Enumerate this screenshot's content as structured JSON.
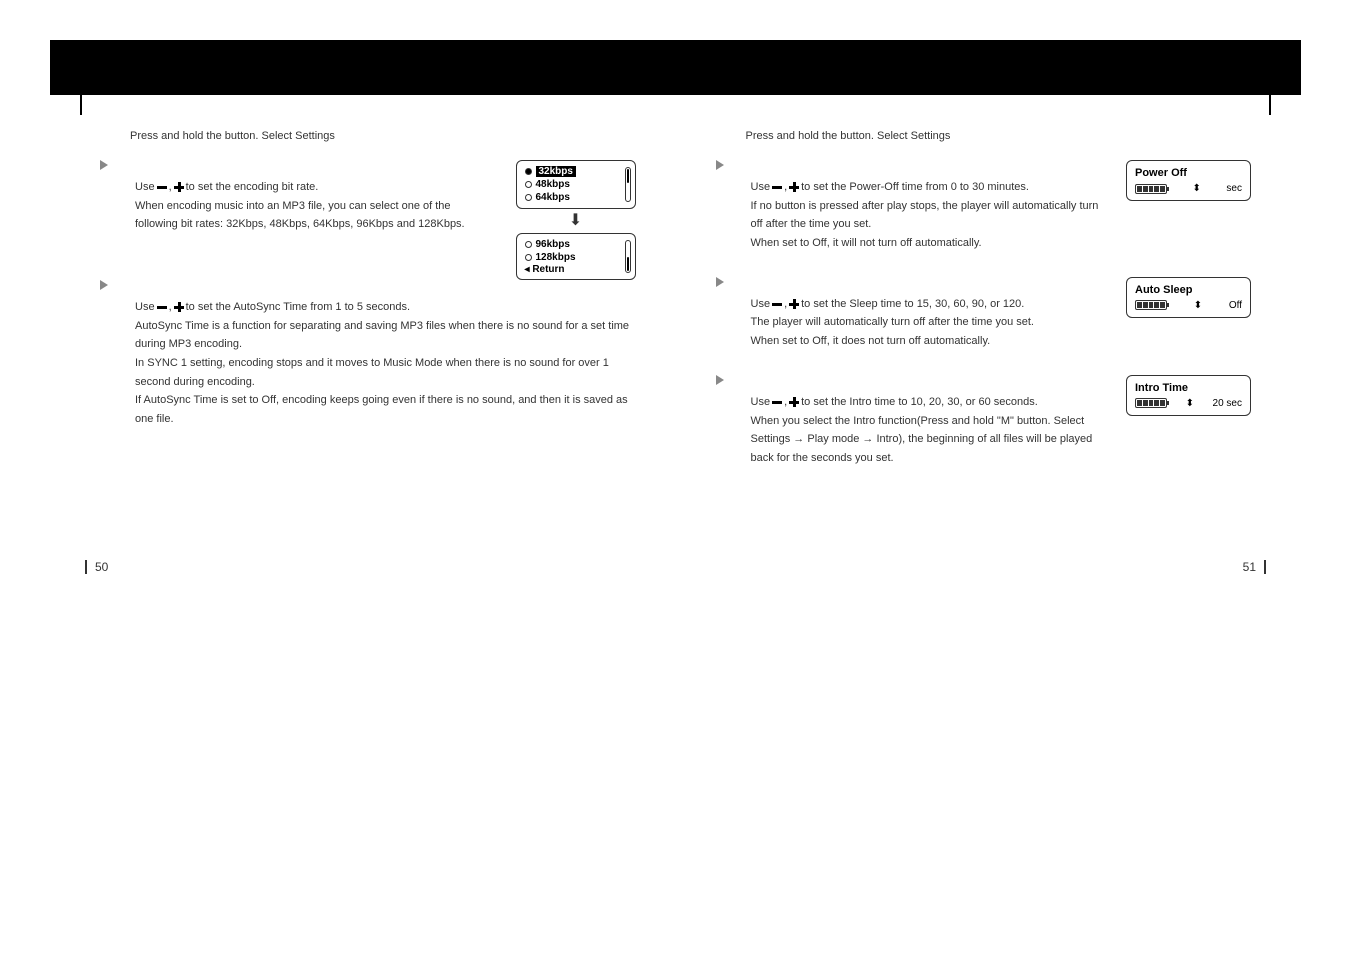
{
  "left": {
    "subtitle_pre": "Press and hold the ",
    "subtitle_post": " button. Select Settings",
    "section1": {
      "use_pre": "Use ",
      "use_post": " to set the encoding bit rate.",
      "desc": "When encoding music into an MP3 file, you can select one of the following bit rates: 32Kbps, 48Kbps, 64Kbps, 96Kbps and 128Kbps."
    },
    "section2": {
      "use_pre": "Use ",
      "use_post": " to set the AutoSync Time from 1 to 5 seconds.",
      "desc1": "AutoSync Time is a function for separating and saving MP3 files when there is no sound for a set time during MP3 encoding.",
      "desc2": "In SYNC 1 setting, encoding stops and it moves to Music Mode when there is no sound for over 1 second during encoding.",
      "desc3": "If AutoSync Time is set to Off, encoding keeps going even if there is no sound, and then it is saved as one file."
    },
    "bitrate_screen": {
      "item1": "32kbps",
      "item2": "48kbps",
      "item3": "64kbps",
      "item4": "96kbps",
      "item5": "128kbps",
      "return": "Return"
    },
    "page_num": "50"
  },
  "right": {
    "subtitle_pre": "Press and hold the ",
    "subtitle_post": " button. Select Settings",
    "section1": {
      "use_pre": "Use ",
      "use_post": " to set the Power-Off time from 0 to 30 minutes.",
      "desc1": "If no button is pressed after play stops, the player will automatically turn off after the time you set.",
      "desc2": "When set to Off, it will not turn off automatically."
    },
    "section2": {
      "use_pre": "Use ",
      "use_post": " to set the Sleep time to 15, 30, 60, 90, or 120.",
      "desc1": "The player will automatically turn off after the time you set.",
      "desc2": "When set to Off, it does not turn off automatically."
    },
    "section3": {
      "use_pre": "Use ",
      "use_post": " to set the Intro time to 10, 20, 30, or 60 seconds.",
      "desc1": "When you select the Intro function(Press and hold \"M\" button. Select Settings → Play mode → Intro), the beginning of all files will be played back for the seconds you set."
    },
    "screen1": {
      "title": "Power Off",
      "value": "sec"
    },
    "screen2": {
      "title": "Auto Sleep",
      "value": "Off"
    },
    "screen3": {
      "title": "Intro Time",
      "value": "20 sec"
    },
    "page_num": "51"
  }
}
